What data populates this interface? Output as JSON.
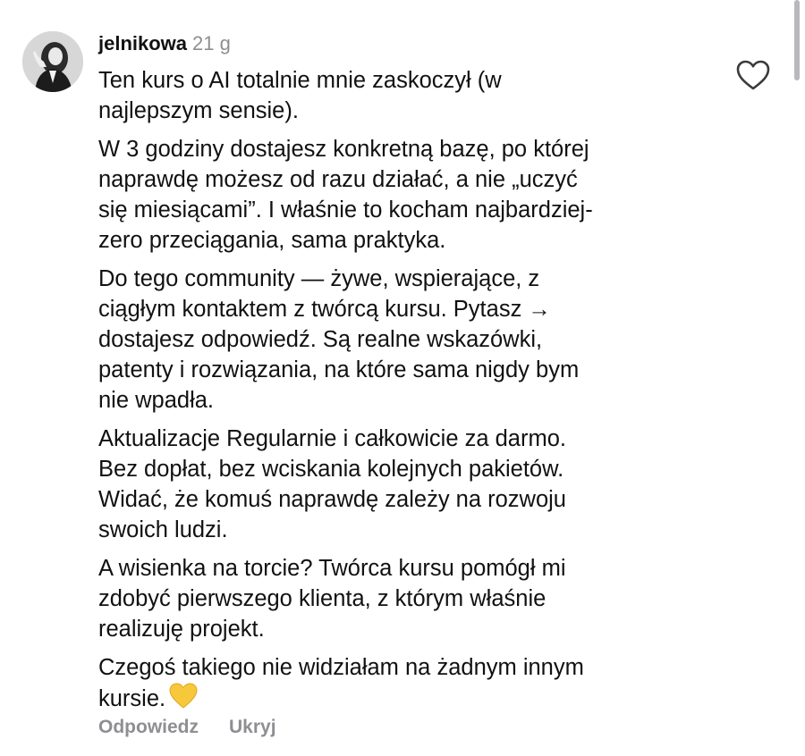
{
  "comment": {
    "username": "jelnikowa",
    "time": "21 g",
    "paragraphs": [
      "Ten kurs o AI totalnie mnie zaskoczył (w\nnajlepszym sensie).",
      "W 3 godziny dostajesz konkretną bazę, po której\nnaprawdę możesz od razu działać, a nie „uczyć\nsię miesiącami”. I właśnie to kocham najbardziej-\nzero przeciągania, sama praktyka.",
      "Do tego community — żywe, wspierające, z\nciągłym kontaktem z twórcą kursu. Pytasz →\ndostajesz odpowiedź. Są realne wskazówki,\npatenty i rozwiązania, na które sama nigdy bym\nnie wpadła.",
      "Aktualizacje Regularnie i całkowicie za darmo.\nBez dopłat, bez wciskania kolejnych pakietów.\nWidać, że komuś naprawdę zależy na rozwoju\nswoich ludzi.",
      "A wisienka na torcie? Twórca kursu pomógł mi\nzdobyć pierwszego klienta, z którym właśnie\nrealizuję projekt.",
      "Czegoś takiego nie widziałam na żadnym innym\nkursie."
    ],
    "emoji_icon": "yellow-heart-icon",
    "emoji_color": "#F7C83B",
    "reply_label": "Odpowiedz",
    "hide_label": "Ukryj",
    "like_icon": "heart-outline-icon"
  },
  "colors": {
    "text": "#111111",
    "muted": "#8E8E93",
    "scrollbar": "#B9B9BD"
  }
}
